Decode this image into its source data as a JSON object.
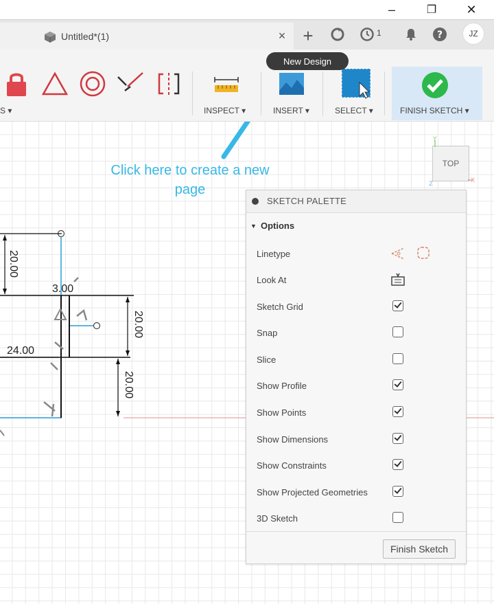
{
  "window": {
    "minimize_label": "–",
    "restore_label": "❐",
    "close_label": "✕"
  },
  "tabbar": {
    "doc_title": "Untitled*(1)",
    "close_label": "×",
    "new_tab_label": "+",
    "job_count": "1",
    "user_initials": "JZ"
  },
  "toolbar": {
    "cut_label": "S ▾",
    "inspect_label": "INSPECT ▾",
    "insert_label": "INSERT ▾",
    "select_label": "SELECT ▾",
    "finish_sketch_label": "FINISH SKETCH ▾",
    "tooltip": "New Design"
  },
  "annotation": {
    "line1": "Click here to create a new",
    "line2": "page"
  },
  "dimensions": {
    "d1": "20.00",
    "d2": "3.00",
    "d3": "20.00",
    "d4": "24.00",
    "d5": "20.00"
  },
  "viewcube": {
    "label": "TOP",
    "axis_y": "Y",
    "axis_x": "X",
    "axis_z": "Z"
  },
  "palette": {
    "title": "SKETCH PALETTE",
    "options_title": "Options",
    "rows": [
      {
        "label": "Linetype",
        "type": "icons"
      },
      {
        "label": "Look At",
        "type": "icon"
      },
      {
        "label": "Sketch Grid",
        "type": "checkbox",
        "checked": true
      },
      {
        "label": "Snap",
        "type": "checkbox",
        "checked": false
      },
      {
        "label": "Slice",
        "type": "checkbox",
        "checked": false
      },
      {
        "label": "Show Profile",
        "type": "checkbox",
        "checked": true
      },
      {
        "label": "Show Points",
        "type": "checkbox",
        "checked": true
      },
      {
        "label": "Show Dimensions",
        "type": "checkbox",
        "checked": true
      },
      {
        "label": "Show Constraints",
        "type": "checkbox",
        "checked": true
      },
      {
        "label": "Show Projected Geometries",
        "type": "checkbox",
        "checked": true
      },
      {
        "label": "3D Sketch",
        "type": "checkbox",
        "checked": false
      }
    ],
    "finish_button": "Finish Sketch"
  },
  "colors": {
    "accent_blue": "#37b8e6",
    "finish_green": "#2db84b",
    "lock_red": "#e0464d",
    "tool_red": "#d0383e"
  }
}
